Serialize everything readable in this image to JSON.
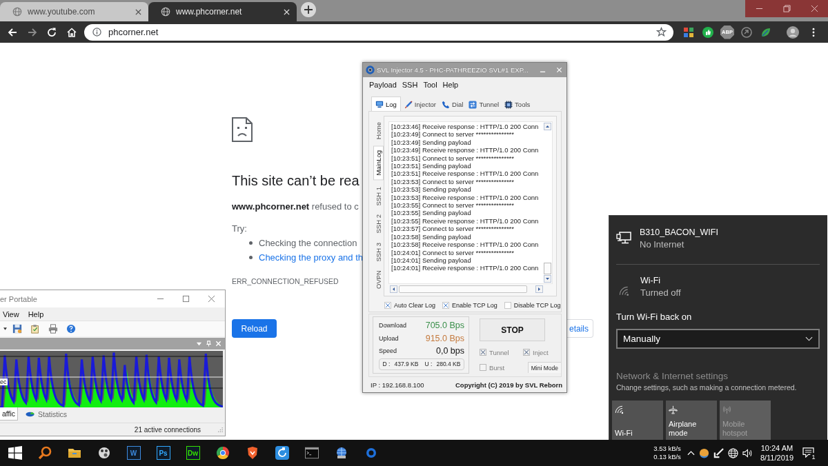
{
  "browser": {
    "tabs": [
      {
        "title": "www.youtube.com",
        "selected": false
      },
      {
        "title": "www.phcorner.net",
        "selected": true
      }
    ],
    "address": "phcorner.net",
    "extension_badge": "ABP"
  },
  "error_page": {
    "title": "This site can’t be rea",
    "message": "**www.phcorner.net** refused to c",
    "try_label": "Try:",
    "suggestions": [
      {
        "text": "Checking the connection",
        "kind": "text"
      },
      {
        "text": "Checking the proxy and th",
        "kind": "link"
      }
    ],
    "error_code": "ERR_CONNECTION_REFUSED",
    "reload_button": "Reload",
    "details_button": "etails"
  },
  "injector": {
    "title": "SVL Injector 4.5 - PHC-PATHREEZIO SVL#1 EXP...",
    "menu": [
      "Payload",
      "SSH",
      "Tool",
      "Help"
    ],
    "tabs": [
      {
        "label": "Log",
        "selected": true
      },
      {
        "label": "Injector",
        "selected": false
      },
      {
        "label": "Dial",
        "selected": false
      },
      {
        "label": "Tunnel",
        "selected": false
      },
      {
        "label": "Tools",
        "selected": false
      }
    ],
    "side_tabs": [
      {
        "label": "Home",
        "selected": false
      },
      {
        "label": "MainLog",
        "selected": true
      },
      {
        "label": "SSH 1",
        "selected": false
      },
      {
        "label": "SSH 2",
        "selected": false
      },
      {
        "label": "SSH 3",
        "selected": false
      },
      {
        "label": "OVPN",
        "selected": false
      }
    ],
    "log": [
      "[10:23:46] Receive response : HTTP/1.0 200 Conn",
      "[10:23:49] Connect to server ***************",
      "[10:23:49] Sending payload",
      "[10:23:49] Receive response : HTTP/1.0 200 Conn",
      "[10:23:51] Connect to server ***************",
      "[10:23:51] Sending payload",
      "[10:23:51] Receive response : HTTP/1.0 200 Conn",
      "[10:23:53] Connect to server ***************",
      "[10:23:53] Sending payload",
      "[10:23:53] Receive response : HTTP/1.0 200 Conn",
      "[10:23:55] Connect to server ***************",
      "[10:23:55] Sending payload",
      "[10:23:55] Receive response : HTTP/1.0 200 Conn",
      "[10:23:57] Connect to server ***************",
      "[10:23:58] Sending payload",
      "[10:23:58] Receive response : HTTP/1.0 200 Conn",
      "[10:24:01] Connect to server ***************",
      "[10:24:01] Sending payload",
      "[10:24:01] Receive response : HTTP/1.0 200 Conn"
    ],
    "options": [
      {
        "label": "Auto Clear Log",
        "checked": true
      },
      {
        "label": "Enable TCP Log",
        "checked": true
      },
      {
        "label": "Disable TCP Log",
        "checked": false
      }
    ],
    "stats": [
      {
        "label": "Download",
        "value": "705.0 Bps",
        "color": "#3a8f4a"
      },
      {
        "label": "Upload",
        "value": "915.0 Bps",
        "color": "#c47a3e"
      },
      {
        "label": "Speed",
        "value": "0,0 bps",
        "color": "#111111"
      }
    ],
    "totals": [
      {
        "label": "D :",
        "value": "437.9 KB"
      },
      {
        "label": "U :",
        "value": "280.4 KB"
      }
    ],
    "stop_button": "STOP",
    "modes": [
      {
        "label": "Tunnel",
        "checked": true,
        "disabled": true
      },
      {
        "label": "Inject",
        "checked": true,
        "disabled": true
      },
      {
        "label": "Burst",
        "checked": false,
        "disabled": true
      }
    ],
    "mini_mode": "Mini Mode",
    "ip": "IP : 192.168.8.100",
    "copyright": "Copyright (C) 2019 by SVL Reborn"
  },
  "traffic_window": {
    "title": "er Portable",
    "menu": [
      "View",
      "Help"
    ],
    "graph_label": "ec",
    "tabs": [
      {
        "label": "affic",
        "selected": true
      },
      {
        "label": "Statistics",
        "selected": false
      }
    ],
    "status": "21 active connections"
  },
  "network_flyout": {
    "connection": {
      "name": "B310_BACON_WIFI",
      "status": "No Internet"
    },
    "wifi": {
      "name": "Wi-Fi",
      "status": "Turned off"
    },
    "turn_on_label": "Turn Wi-Fi back on",
    "turn_on_value": "Manually",
    "settings_link": "Network & Internet settings",
    "settings_hint": "Change settings, such as making a connection metered.",
    "quick_actions": [
      {
        "label": "Wi-Fi",
        "on": false,
        "disabled": false
      },
      {
        "label": "Airplane mode",
        "on": false,
        "disabled": false
      },
      {
        "label": "Mobile hotspot",
        "on": false,
        "disabled": true
      }
    ]
  },
  "taskbar": {
    "tiles": [
      {
        "glyph": "W",
        "color": "#3d8be0"
      },
      {
        "glyph": "Ps",
        "color": "#31a8ff"
      },
      {
        "glyph": "Dw",
        "color": "#35e000"
      }
    ],
    "net_speed": [
      "3.53 kB/s",
      "0.13 kB/s"
    ],
    "time": "10:24 AM",
    "date": "8/11/2019",
    "notifications": "1"
  }
}
